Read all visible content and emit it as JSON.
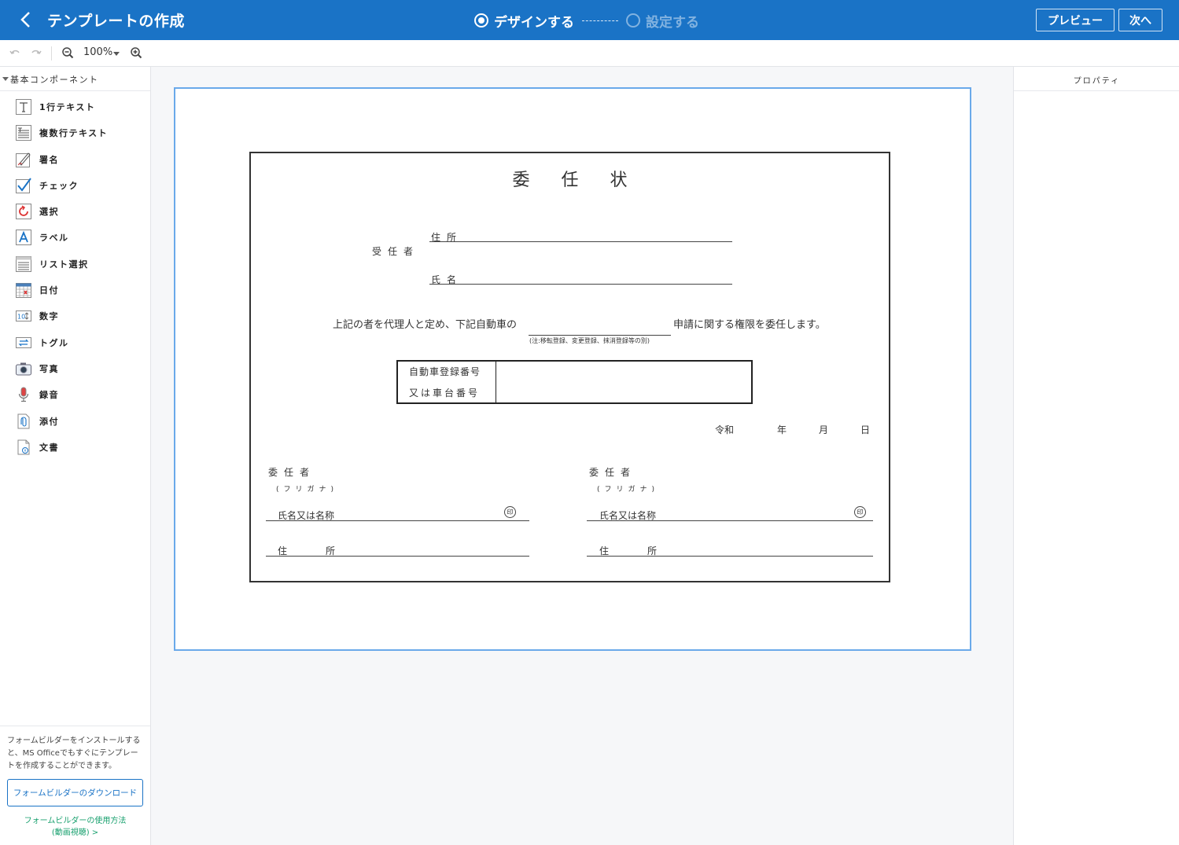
{
  "header": {
    "title": "テンプレートの作成",
    "step1": "デザインする",
    "step2": "設定する",
    "preview": "プレビュー",
    "next": "次へ"
  },
  "toolbar": {
    "zoom": "100%"
  },
  "left_panel": {
    "section": "基本コンポーネント",
    "items": [
      {
        "label": "1行テキスト",
        "icon": "text-icon"
      },
      {
        "label": "複数行テキスト",
        "icon": "multiline-text-icon"
      },
      {
        "label": "署名",
        "icon": "signature-icon"
      },
      {
        "label": "チェック",
        "icon": "check-icon"
      },
      {
        "label": "選択",
        "icon": "select-icon"
      },
      {
        "label": "ラベル",
        "icon": "label-icon"
      },
      {
        "label": "リスト選択",
        "icon": "list-icon"
      },
      {
        "label": "日付",
        "icon": "calendar-icon"
      },
      {
        "label": "数字",
        "icon": "number-icon"
      },
      {
        "label": "トグル",
        "icon": "toggle-icon"
      },
      {
        "label": "写真",
        "icon": "camera-icon"
      },
      {
        "label": "録音",
        "icon": "microphone-icon"
      },
      {
        "label": "添付",
        "icon": "attachment-icon"
      },
      {
        "label": "文書",
        "icon": "document-icon"
      }
    ],
    "footer_text": "フォームビルダーをインストールすると、MS Officeでもすぐにテンプレートを作成することができます。",
    "download_button": "フォームビルダーのダウンロード",
    "howto_line1": "フォームビルダーの使用方法",
    "howto_line2": "(動画視聴) >"
  },
  "right_panel": {
    "title": "プロパティ"
  },
  "document": {
    "title": "委任状",
    "agent_label": "受任者",
    "address_label": "住所",
    "name_label": "氏名",
    "sentence_left": "上記の者を代理人と定め、下記自動車の",
    "sentence_right": "申請に関する権限を委任します。",
    "note": "(注:移転登録、変更登録、抹消登録等の別)",
    "car_label1": "自動車登録番号",
    "car_label2": "又は車台番号",
    "era": "令和",
    "year": "年",
    "month": "月",
    "day": "日",
    "principal_label": "委任者",
    "furigana": "(フリガナ)",
    "principal_name": "氏名又は名称",
    "seal": "印",
    "principal_address": "住所"
  },
  "colors": {
    "header_bg": "#1a73c6",
    "accent": "#1a73c6",
    "link": "#18a06e",
    "page_border": "#6aa9ea"
  }
}
